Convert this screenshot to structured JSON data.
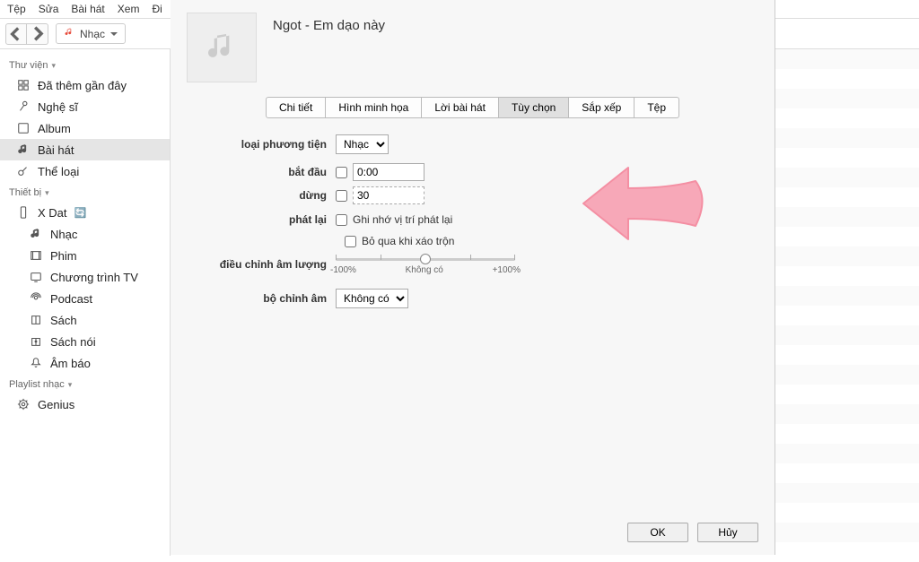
{
  "menubar": [
    "Tệp",
    "Sửa",
    "Bài hát",
    "Xem",
    "Đi"
  ],
  "nav": {
    "category_label": "Nhạc"
  },
  "sidebar": {
    "library": {
      "title": "Thư viện",
      "items": [
        {
          "key": "recent",
          "label": "Đã thêm gần đây"
        },
        {
          "key": "artists",
          "label": "Nghệ sĩ"
        },
        {
          "key": "albums",
          "label": "Album"
        },
        {
          "key": "songs",
          "label": "Bài hát"
        },
        {
          "key": "genres",
          "label": "Thể loại"
        }
      ]
    },
    "devices": {
      "title": "Thiết bị",
      "device_name": "X Dat",
      "items": [
        {
          "key": "music",
          "label": "Nhạc"
        },
        {
          "key": "movies",
          "label": "Phim"
        },
        {
          "key": "tv",
          "label": "Chương trình TV"
        },
        {
          "key": "podcast",
          "label": "Podcast"
        },
        {
          "key": "books",
          "label": "Sách"
        },
        {
          "key": "audiob",
          "label": "Sách nói"
        },
        {
          "key": "tones",
          "label": "Âm báo"
        }
      ]
    },
    "playlists": {
      "title": "Playlist nhạc",
      "items": [
        {
          "key": "genius",
          "label": "Genius"
        }
      ]
    }
  },
  "dialog": {
    "title": "Ngot - Em dạo này",
    "tabs": [
      "Chi tiết",
      "Hình minh họa",
      "Lời bài hát",
      "Tùy chọn",
      "Sắp xếp",
      "Tệp"
    ],
    "active_tab": "Tùy chọn",
    "labels": {
      "media_kind": "loại phương tiện",
      "start": "bắt đầu",
      "stop": "dừng",
      "playback": "phát lại",
      "remember": "Ghi nhớ vị trí phát lại",
      "skip": "Bỏ qua khi xáo trộn",
      "volume": "điều chỉnh âm lượng",
      "eq": "bộ chỉnh âm"
    },
    "values": {
      "media_kind": "Nhạc",
      "start": "0:00",
      "stop": "30",
      "eq": "Không có"
    },
    "slider": {
      "left": "-100%",
      "center": "Không có",
      "right": "+100%"
    },
    "buttons": {
      "ok": "OK",
      "cancel": "Hủy"
    }
  }
}
